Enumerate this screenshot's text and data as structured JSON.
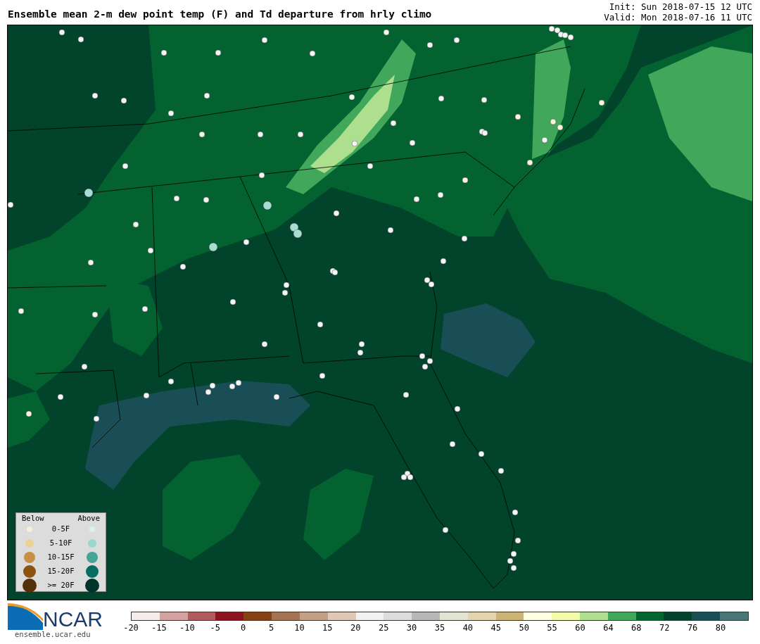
{
  "title": "Ensemble mean 2-m dew point temp (F) and Td departure from hrly climo",
  "init": "Init: Sun 2018-07-15 12 UTC",
  "valid": "Valid: Mon 2018-07-16 11 UTC",
  "legend": {
    "below_heading": "Below",
    "above_heading": "Above",
    "rows": [
      {
        "label": "0-5F",
        "below": {
          "color": "#f8efd8"
        },
        "above": {
          "color": "#dcf0ee"
        }
      },
      {
        "label": "5-10F",
        "below": {
          "color": "#ebd196"
        },
        "above": {
          "color": "#9ad8cc"
        }
      },
      {
        "label": "10-15F",
        "below": {
          "color": "#c98f43"
        },
        "above": {
          "color": "#44a497"
        }
      },
      {
        "label": "15-20F",
        "below": {
          "color": "#8c520f"
        },
        "above": {
          "color": "#086c60"
        }
      },
      {
        "label": ">= 20F",
        "below": {
          "color": "#54300a"
        },
        "above": {
          "color": "#00352d"
        }
      }
    ]
  },
  "logo": {
    "name": "NCAR",
    "url": "ensemble.ucar.edu"
  },
  "colorbar": {
    "segments": [
      {
        "color": "#f5eceb"
      },
      {
        "color": "#d4a0a0"
      },
      {
        "color": "#b05c5c"
      },
      {
        "color": "#8c141e"
      },
      {
        "color": "#864212"
      },
      {
        "color": "#a67352"
      },
      {
        "color": "#c39f86"
      },
      {
        "color": "#e0c7b6"
      },
      {
        "color": "#f1f1f1"
      },
      {
        "color": "#dcdcdc"
      },
      {
        "color": "#b8b8b8"
      },
      {
        "color": "#e3e3d3"
      },
      {
        "color": "#e3d4ad"
      },
      {
        "color": "#cdb474"
      },
      {
        "color": "#fefee0"
      },
      {
        "color": "#f4fbaa"
      },
      {
        "color": "#addf8f"
      },
      {
        "color": "#41a85b"
      },
      {
        "color": "#026631"
      },
      {
        "color": "#02442b"
      },
      {
        "color": "#1a4e56"
      },
      {
        "color": "#4a7676"
      }
    ],
    "ticks": [
      "-20",
      "-15",
      "-10",
      "-5",
      "0",
      "5",
      "10",
      "15",
      "20",
      "25",
      "30",
      "35",
      "40",
      "45",
      "50",
      "55",
      "60",
      "64",
      "68",
      "72",
      "76",
      "80"
    ]
  }
}
